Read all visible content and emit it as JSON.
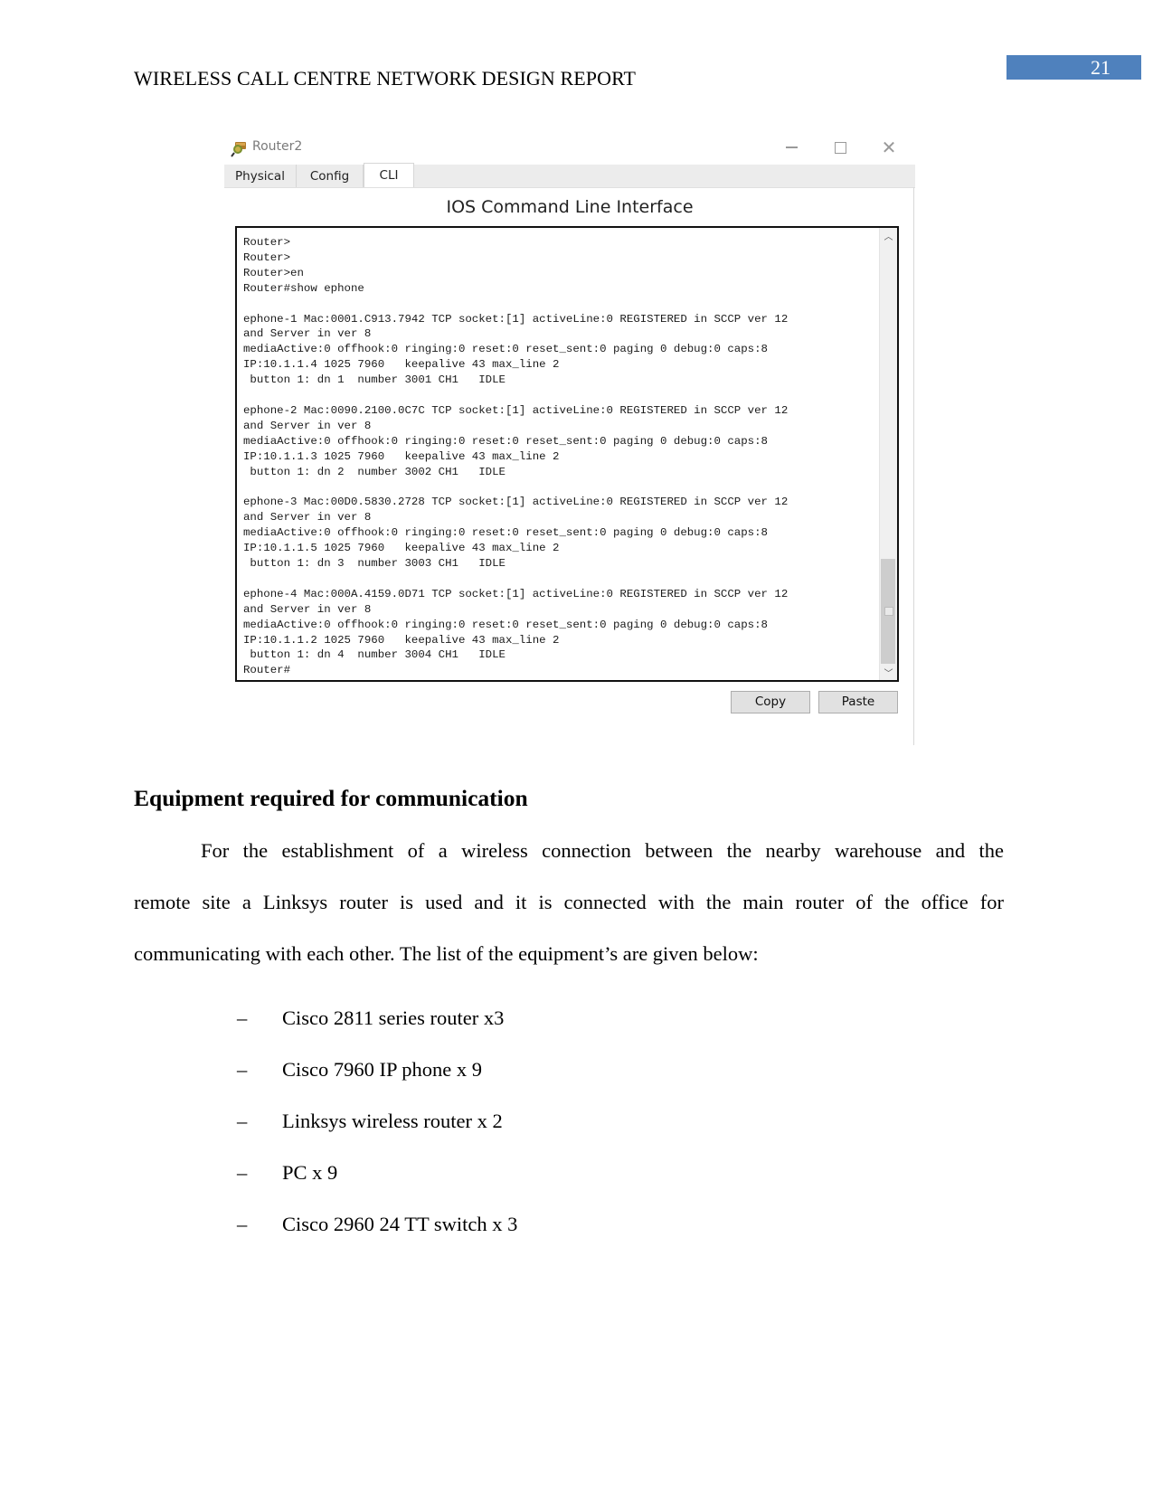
{
  "header": {
    "running_title": "WIRELESS CALL CENTRE NETWORK DESIGN REPORT",
    "page_number": "21",
    "page_number_bg": "#4f81bd"
  },
  "screenshot": {
    "window_title": "Router2",
    "window_controls": {
      "minimize": "minimize-icon",
      "maximize": "maximize-icon",
      "close": "close-icon"
    },
    "tabs": [
      {
        "label": "Physical",
        "active": false
      },
      {
        "label": "Config",
        "active": false
      },
      {
        "label": "CLI",
        "active": true
      }
    ],
    "heading": "IOS Command Line Interface",
    "cli_lines": [
      "Router>",
      "Router>",
      "Router>en",
      "Router#show ephone",
      "",
      "ephone-1 Mac:0001.C913.7942 TCP socket:[1] activeLine:0 REGISTERED in SCCP ver 12",
      "and Server in ver 8",
      "mediaActive:0 offhook:0 ringing:0 reset:0 reset_sent:0 paging 0 debug:0 caps:8",
      "IP:10.1.1.4 1025 7960   keepalive 43 max_line 2",
      " button 1: dn 1  number 3001 CH1   IDLE",
      "",
      "ephone-2 Mac:0090.2100.0C7C TCP socket:[1] activeLine:0 REGISTERED in SCCP ver 12",
      "and Server in ver 8",
      "mediaActive:0 offhook:0 ringing:0 reset:0 reset_sent:0 paging 0 debug:0 caps:8",
      "IP:10.1.1.3 1025 7960   keepalive 43 max_line 2",
      " button 1: dn 2  number 3002 CH1   IDLE",
      "",
      "ephone-3 Mac:00D0.5830.2728 TCP socket:[1] activeLine:0 REGISTERED in SCCP ver 12",
      "and Server in ver 8",
      "mediaActive:0 offhook:0 ringing:0 reset:0 reset_sent:0 paging 0 debug:0 caps:8",
      "IP:10.1.1.5 1025 7960   keepalive 43 max_line 2",
      " button 1: dn 3  number 3003 CH1   IDLE",
      "",
      "ephone-4 Mac:000A.4159.0D71 TCP socket:[1] activeLine:0 REGISTERED in SCCP ver 12",
      "and Server in ver 8",
      "mediaActive:0 offhook:0 ringing:0 reset:0 reset_sent:0 paging 0 debug:0 caps:8",
      "IP:10.1.1.2 1025 7960   keepalive 43 max_line 2",
      " button 1: dn 4  number 3004 CH1   IDLE",
      "Router#"
    ],
    "scroll_position": 1.0,
    "scroll_visible_fraction": 0.25,
    "buttons": {
      "copy": "Copy",
      "paste": "Paste"
    }
  },
  "section": {
    "heading": "Equipment required for communication",
    "paragraph_lines": [
      "For the establishment of a wireless connection between the nearby warehouse and the",
      "remote site a Linksys router is used and it is connected with the main router of the office for",
      "communicating with each other. The list of the equipment’s are given below:"
    ],
    "list_marker": "–",
    "equipment": [
      "Cisco 2811 series router x3",
      "Cisco 7960 IP phone x 9",
      "Linksys wireless router x 2",
      "PC x 9",
      "Cisco 2960 24 TT switch x 3"
    ]
  }
}
